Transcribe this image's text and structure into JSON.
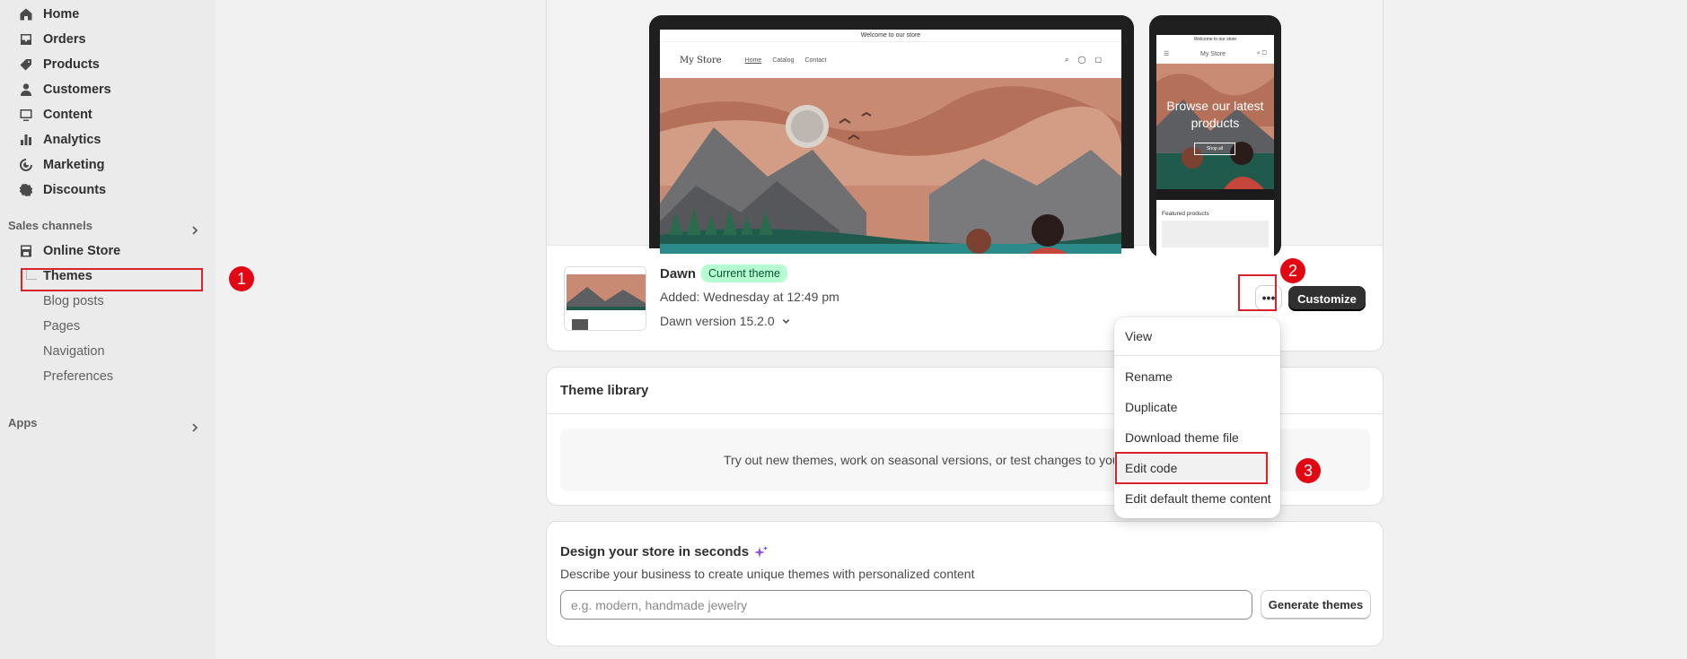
{
  "sidebar": {
    "items": [
      {
        "label": "Home",
        "icon": "home-icon"
      },
      {
        "label": "Orders",
        "icon": "inbox-icon"
      },
      {
        "label": "Products",
        "icon": "tag-icon"
      },
      {
        "label": "Customers",
        "icon": "person-icon"
      },
      {
        "label": "Content",
        "icon": "content-icon"
      },
      {
        "label": "Analytics",
        "icon": "bar-chart-icon"
      },
      {
        "label": "Marketing",
        "icon": "target-icon"
      },
      {
        "label": "Discounts",
        "icon": "discount-icon"
      }
    ],
    "sales_channels_label": "Sales channels",
    "online_store_label": "Online Store",
    "sub_items": [
      "Themes",
      "Blog posts",
      "Pages",
      "Navigation",
      "Preferences"
    ],
    "apps_label": "Apps"
  },
  "annotations": [
    "1",
    "2",
    "3"
  ],
  "preview": {
    "announcement": "Welcome to our store",
    "store_name": "My Store",
    "nav_links": [
      "Home",
      "Catalog",
      "Contact"
    ],
    "phone_announcement": "Welcome to our store",
    "phone_hero_text": "Browse our latest products",
    "phone_hero_button": "Shop all",
    "phone_featured": "Featured products"
  },
  "theme": {
    "name": "Dawn",
    "badge": "Current theme",
    "added": "Added: Wednesday at 12:49 pm",
    "version": "Dawn version 15.2.0",
    "more_label": "•••",
    "customize_label": "Customize"
  },
  "menu": {
    "items": [
      "View",
      "Rename",
      "Duplicate",
      "Download theme file",
      "Edit code",
      "Edit default theme content"
    ]
  },
  "library": {
    "title": "Theme library",
    "text": "Try out new themes, work on seasonal versions, or test changes to you"
  },
  "design": {
    "title": "Design your store in seconds",
    "description": "Describe your business to create unique themes with personalized content",
    "placeholder": "e.g. modern, handmade jewelry",
    "button": "Generate themes"
  },
  "colors": {
    "annotation_red": "#e30613",
    "badge_green": "#b4fed2",
    "primary_button": "#303030"
  }
}
